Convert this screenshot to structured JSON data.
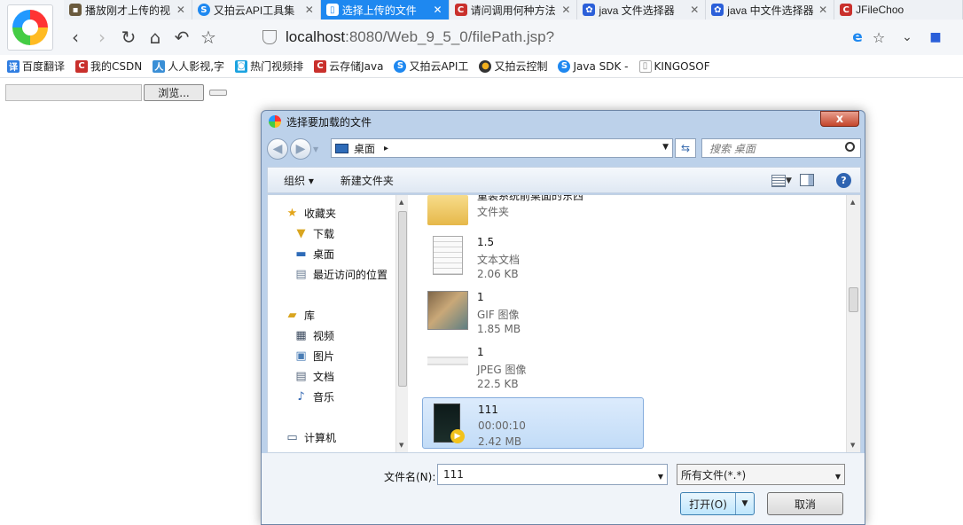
{
  "tabs": [
    {
      "title": "播放刚才上传的视",
      "icon": "page-icon",
      "color": "#6a5a3e"
    },
    {
      "title": "又拍云API工具集",
      "icon": "upyun-icon",
      "color": "#1e88f0"
    },
    {
      "title": "选择上传的文件",
      "icon": "page-icon",
      "color": "#ffffff",
      "active": true
    },
    {
      "title": "请问调用何种方法",
      "icon": "csdn-icon",
      "color": "#c9302c"
    },
    {
      "title": "java 文件选择器",
      "icon": "baidu-icon",
      "color": "#2b5fd9"
    },
    {
      "title": "java 中文件选择器",
      "icon": "baidu-icon",
      "color": "#2b5fd9"
    },
    {
      "title": "JFileChoo",
      "icon": "csdn-icon",
      "color": "#c9302c"
    }
  ],
  "address": {
    "host": "localhost",
    "rest": ":8080/Web_9_5_0/filePath.jsp?"
  },
  "bookmarks": [
    {
      "label": "百度翻译",
      "icon": "translate-icon",
      "color": "#2f7de1",
      "glyph": "译"
    },
    {
      "label": "我的CSDN",
      "icon": "csdn-icon",
      "color": "#c9302c",
      "glyph": "C"
    },
    {
      "label": "人人影视,字",
      "icon": "rrys-icon",
      "color": "#3a8fd6",
      "glyph": "人"
    },
    {
      "label": "热门视频排",
      "icon": "bilibili-icon",
      "color": "#1ba3e0",
      "glyph": "◙"
    },
    {
      "label": "云存储Java",
      "icon": "csdn-icon",
      "color": "#c9302c",
      "glyph": "C"
    },
    {
      "label": "又拍云API工",
      "icon": "upyun-icon",
      "color": "#1e88f0",
      "glyph": "S"
    },
    {
      "label": "又拍云控制",
      "icon": "control-icon",
      "color": "#333333",
      "glyph": "●"
    },
    {
      "label": "Java SDK -",
      "icon": "upyun-icon",
      "color": "#1e88f0",
      "glyph": "S"
    },
    {
      "label": "KINGOSOF",
      "icon": "page-icon",
      "color": "#ffffff",
      "glyph": "▯"
    }
  ],
  "page": {
    "browse_label": "浏览..."
  },
  "dialog": {
    "title": "选择要加载的文件",
    "close": "x",
    "path": "桌面",
    "path_sep": "▸",
    "search_placeholder": "搜索 桌面",
    "toolbar": {
      "organize": "组织 ▾",
      "new_folder": "新建文件夹",
      "help": "?"
    },
    "nav": [
      {
        "label": "收藏夹",
        "icon": "star-icon",
        "glyph": "★",
        "color": "#e3a51a"
      },
      {
        "label": "下载",
        "icon": "download-folder-icon",
        "glyph": "▼",
        "color": "#d9a520",
        "child": true
      },
      {
        "label": "桌面",
        "icon": "desktop-icon",
        "glyph": "▬",
        "color": "#2e6bb8",
        "child": true
      },
      {
        "label": "最近访问的位置",
        "icon": "recent-icon",
        "glyph": "▤",
        "color": "#6d7f96",
        "child": true
      },
      {
        "label": "库",
        "icon": "library-icon",
        "glyph": "▰",
        "color": "#d9a520"
      },
      {
        "label": "视频",
        "icon": "video-icon",
        "glyph": "▦",
        "color": "#3b4a5e",
        "child": true
      },
      {
        "label": "图片",
        "icon": "picture-icon",
        "glyph": "▣",
        "color": "#4a7db5",
        "child": true
      },
      {
        "label": "文档",
        "icon": "document-icon",
        "glyph": "▤",
        "color": "#5b6b80",
        "child": true
      },
      {
        "label": "音乐",
        "icon": "music-icon",
        "glyph": "♪",
        "color": "#2f64b1",
        "child": true
      },
      {
        "label": "计算机",
        "icon": "computer-icon",
        "glyph": "▭",
        "color": "#3d5878"
      }
    ],
    "files": [
      {
        "name": "重装系统前桌面的东西",
        "type": "文件夹",
        "size": "",
        "icon": "folder-icon"
      },
      {
        "name": "1.5",
        "type": "文本文档",
        "size": "2.06 KB",
        "icon": "text-file-icon"
      },
      {
        "name": "1",
        "type": "GIF 图像",
        "size": "1.85 MB",
        "icon": "gif-thumbnail-icon"
      },
      {
        "name": "1",
        "type": "JPEG 图像",
        "size": "22.5 KB",
        "icon": "jpeg-thumbnail-icon"
      },
      {
        "name": "111",
        "type": "00:00:10",
        "size": "2.42 MB",
        "icon": "video-thumbnail-icon",
        "selected": true
      }
    ],
    "filename_label": "文件名(N):",
    "filename_value": "111",
    "filetype_value": "所有文件(*.*)",
    "open_label": "打开(O)",
    "cancel_label": "取消"
  }
}
